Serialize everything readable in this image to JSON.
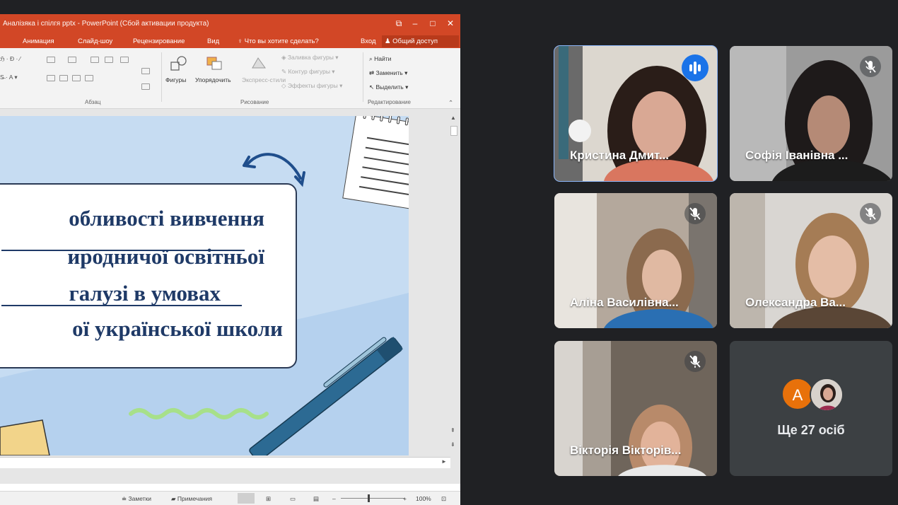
{
  "ppt": {
    "window_title": "Аналізяка і спілгя pptx - PowerPoint (Сбой активации продукта)",
    "menu": [
      "Анимация",
      "Слайд-шоу",
      "Рецензирование",
      "Вид"
    ],
    "tell_me": "Что вы хотите сделать?",
    "signin": "Вход",
    "share": "Общий доступ",
    "ribbon": {
      "shapes_label": "Фигуры",
      "arrange_label": "Упорядочить",
      "express_styles_label": "Экспресс-стили",
      "fill_label": "Заливка фигуры",
      "outline_label": "Контур фигуры",
      "effects_label": "Эффекты фигуры",
      "find_label": "Найти",
      "replace_label": "Заменить",
      "select_label": "Выделить",
      "group_paragraph": "Абзац",
      "group_drawing": "Рисование",
      "group_editing": "Редактирование"
    },
    "slide": {
      "lines": [
        "обливості вивчення",
        "иродничої освітньої",
        "галузі  в умовах",
        "ої української школи"
      ]
    },
    "status": {
      "notes": "Заметки",
      "comments": "Примечания",
      "zoom": "100%"
    }
  },
  "meet": {
    "participants": [
      {
        "name": "Кристина Дмит...",
        "state": "speaking"
      },
      {
        "name": "Софія Іванівна ...",
        "state": "muted"
      },
      {
        "name": "Аліна Василівна...",
        "state": "muted"
      },
      {
        "name": "Олександра Ва...",
        "state": "muted"
      },
      {
        "name": "Вікторія Вікторів...",
        "state": "muted"
      }
    ],
    "more": {
      "avatar_letter": "A",
      "label": "Ще 27 осіб",
      "avatar_color": "#e8710a"
    },
    "colors": {
      "background": "#202124",
      "tile": "#3c4043",
      "active_border": "#8ab4f8",
      "speaking": "#1a73e8"
    }
  }
}
